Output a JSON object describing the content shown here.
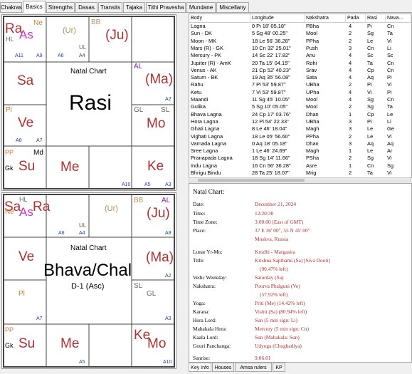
{
  "tabs": [
    "Chakras",
    "Basics",
    "Strengths",
    "Dasas",
    "Transits",
    "Tajaka",
    "Tithi Pravesha",
    "Mundane",
    "Miscellany"
  ],
  "active_tab": "Basics",
  "rasi_chart": {
    "title": "Natal Chart",
    "name": "Rasi",
    "cells": {
      "c1": {
        "main1": "Ra",
        "main2": "As",
        "small": "Ne",
        "sub": "HL",
        "a1": "A11",
        "a2": "A9"
      },
      "c2": {
        "main": "(Ur)",
        "a1": "A6",
        "a2": "A4",
        "ul": "UL"
      },
      "c3": {
        "bb": "BB",
        "main": "(Ju)"
      },
      "c4": {
        "al": "AL",
        "main": "(Ma)",
        "a": "A2"
      },
      "c5": {
        "main": "Sa"
      },
      "c6": {
        "pl": "Pl",
        "main": "Ve",
        "a1": "A8",
        "a2": "A7"
      },
      "c7": {
        "gl": "GL",
        "sl": "SL",
        "main": "Mo"
      },
      "c8": {
        "pp": "PP",
        "md": "Md",
        "gk": "Gk",
        "main": "Su"
      },
      "c9": {
        "main": "Me"
      },
      "c10": {
        "main": "Ke",
        "a1": "A10",
        "a2": "A5",
        "a3": "A3"
      }
    }
  },
  "bhava_chart": {
    "title": "Natal Chart",
    "name": "Bhava/Chal",
    "sub": "D-1 (Asc)",
    "cells": {
      "c1": {
        "sa": "Sa",
        "ra": "Ra",
        "as": "As",
        "hl": "HL",
        "ne": "Ne"
      },
      "c2": {
        "ur": "(Ur)",
        "a1": "A6",
        "a2": "A4",
        "ul": "UL"
      },
      "c3": {
        "bb": "BB",
        "al": "AL",
        "main": "(Ju)",
        "a": "A8"
      },
      "c4": {
        "main": "(Ma)",
        "a": "A2"
      },
      "c5": {
        "main": "Ve"
      },
      "c6": {
        "pl": "Pl",
        "a": "A7"
      },
      "c7": {
        "sl": "SL",
        "gl": "GL",
        "a": "A3"
      },
      "c8": {
        "pp": "PP",
        "gk": "Gk",
        "main": "Su"
      },
      "c9": {
        "main": "Me",
        "a": "A5"
      },
      "c10": {
        "ke": "Ke",
        "mo": "Mo",
        "a": "A10"
      }
    }
  },
  "table": {
    "headers": [
      "Body",
      "Longitude",
      "Nakshatra",
      "Pada",
      "Rasi",
      "Nava..."
    ],
    "rows": [
      [
        "Lagna",
        "0 Pi 18' 05.18\"",
        "PBha",
        "4",
        "Pi",
        "Cn"
      ],
      [
        "Sun - DK",
        "5 Sg 48' 00.25\"",
        "Mool",
        "2",
        "Sg",
        "Ta"
      ],
      [
        "Moon - MK",
        "18 Le 56' 36.28\"",
        "PPha",
        "2",
        "Le",
        "Vi"
      ],
      [
        "Mars (R) - GK",
        "10 Cn 32' 25.01\"",
        "Push",
        "3",
        "Cn",
        "Li"
      ],
      [
        "Mercury - PK",
        "14 Sc 22' 17.82\"",
        "Anu",
        "4",
        "Sc",
        "Sc"
      ],
      [
        "Jupiter (R) - AmK",
        "20 Ta 15' 04.15\"",
        "Rohi",
        "4",
        "Ta",
        "Cn"
      ],
      [
        "Venus - AK",
        "21 Cp 52' 40.23\"",
        "Srav",
        "4",
        "Cp",
        "Cn"
      ],
      [
        "Saturn - BK",
        "19 Aq 35' 56.08\"",
        "Sata",
        "4",
        "Aq",
        "Pi"
      ],
      [
        "Rahu",
        "7 Pi 53' 59.87\"",
        "UBha",
        "2",
        "Pi",
        "Vi"
      ],
      [
        "Ketu",
        "7 Vi 53' 59.87\"",
        "UPha",
        "4",
        "Vi",
        "Pi"
      ],
      [
        "Maandi",
        "11 Sg 45' 10.05\"",
        "Mool",
        "4",
        "Sg",
        "Cn"
      ],
      [
        "Gulika",
        "5 Sg 10' 05.05\"",
        "Mool",
        "2",
        "Sg",
        "Ta"
      ],
      [
        "Bhava Lagna",
        "24 Cp 17' 03.76\"",
        "Dhan",
        "1",
        "Cp",
        "Le"
      ],
      [
        "Hora Lagna",
        "12 Pi 54' 22.33\"",
        "UBha",
        "3",
        "Pi",
        "Li"
      ],
      [
        "Ghati Lagna",
        "8 Le 46' 18.04\"",
        "Magh",
        "3",
        "Le",
        "Ge"
      ],
      [
        "Vighati Lagna",
        "18 Le 05' 56.60\"",
        "PPha",
        "2",
        "Le",
        "Vi"
      ],
      [
        "Varnada Lagna",
        "0 Aq 18' 05.18\"",
        "Dhan",
        "3",
        "Aq",
        "Aq"
      ],
      [
        "Sree Lagna",
        "1 Le 46' 24.69\"",
        "Magh",
        "1",
        "Le",
        "Ar"
      ],
      [
        "Pranapada Lagna",
        "18 Sg 14' 11.66\"",
        "PSha",
        "2",
        "Sg",
        "Vi"
      ],
      [
        "Indu Lagna",
        "16 Cn 56' 36.28\"",
        "Asre",
        "1",
        "Cn",
        "Sg"
      ],
      [
        "Bhrigu Bindu",
        "28 Ta 25' 18.07\"",
        "Mrig",
        "2",
        "Ta",
        "Vi"
      ]
    ]
  },
  "key_info": {
    "heading": "Natal Chart:",
    "rows": [
      {
        "label": "Date:",
        "value": "December 21, 2024"
      },
      {
        "label": "Time:",
        "value": "12:20:30"
      },
      {
        "label": "Time Zone:",
        "value": "3:00:00 (East of GMT)"
      },
      {
        "label": "Place:",
        "value": "37 E 36' 00\", 55 N 45' 00\""
      },
      {
        "label": "",
        "value": "Moskva, Russia"
      },
      {
        "label": "Lunar Yr-Mo:",
        "value": "Krodhi - Margasira"
      },
      {
        "label": "Tithi:",
        "value": "Krishna Sapthami (Sa) [Siva Dooti]"
      },
      {
        "label": "",
        "value": "(90.47% left)"
      },
      {
        "label": "Vedic Weekday:",
        "value": "Saturday (Sa)"
      },
      {
        "label": "Nakshatra:",
        "value": "Poorva Phalguni (Ve)"
      },
      {
        "label": "",
        "value": "(57.92% left)"
      },
      {
        "label": "Yoga:",
        "value": "Priti (Me) (14.42% left)"
      },
      {
        "label": "Karana:",
        "value": "Vishti (Sa) (80.94% left)"
      },
      {
        "label": "Hora Lord:",
        "value": "Sun (5 min sign: Li)"
      },
      {
        "label": "Mahakala Hora:",
        "value": "Mercury (5 min sign: Cn)"
      },
      {
        "label": "Kaala Lord:",
        "value": "Sun (Mahakala: Sun)"
      },
      {
        "label": "Gouri Panchanga:",
        "value": "Udyoga (Choghadiya)"
      },
      {
        "label": "Sunrise:",
        "value": "9:06:01"
      }
    ]
  },
  "bottom_tabs": [
    "Key Info",
    "Houses",
    "Amsa rulers",
    "KP"
  ],
  "active_bottom_tab": "Key Info"
}
